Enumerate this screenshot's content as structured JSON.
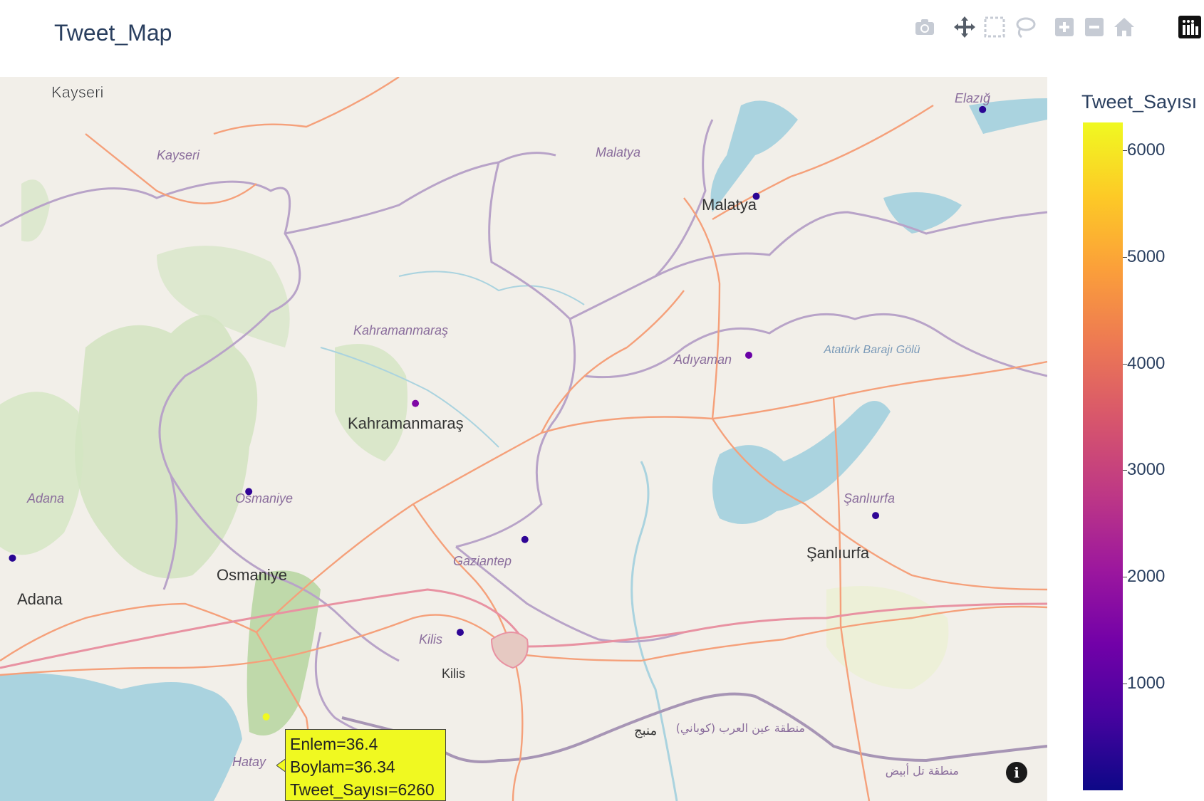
{
  "page": {
    "title": "Tweet_Map"
  },
  "modebar": {
    "icons": [
      "camera-icon",
      "pan-icon",
      "box-select-icon",
      "lasso-icon",
      "zoom-in-icon",
      "zoom-out-icon",
      "home-icon",
      "plotly-logo-icon"
    ]
  },
  "map": {
    "places": [
      {
        "name": "Kayseri",
        "kind": "city"
      },
      {
        "name": "Kayseri",
        "kind": "province"
      },
      {
        "name": "Malatya",
        "kind": "province"
      },
      {
        "name": "Malatya",
        "kind": "city"
      },
      {
        "name": "Elazığ",
        "kind": "province"
      },
      {
        "name": "Kahramanmaraş",
        "kind": "province"
      },
      {
        "name": "Kahramanmaraş",
        "kind": "city"
      },
      {
        "name": "Adıyaman",
        "kind": "province"
      },
      {
        "name": "Atatürk Barajı Gölü",
        "kind": "water"
      },
      {
        "name": "Adana",
        "kind": "province"
      },
      {
        "name": "Osmaniye",
        "kind": "province"
      },
      {
        "name": "Osmaniye",
        "kind": "city"
      },
      {
        "name": "Adana",
        "kind": "city"
      },
      {
        "name": "Gaziantep",
        "kind": "province"
      },
      {
        "name": "Şanlıurfa",
        "kind": "province"
      },
      {
        "name": "Şanlıurfa",
        "kind": "city"
      },
      {
        "name": "Kilis",
        "kind": "province"
      },
      {
        "name": "Kilis",
        "kind": "city"
      },
      {
        "name": "Hatay",
        "kind": "province"
      },
      {
        "name": "منبج",
        "kind": "city"
      },
      {
        "name": "منطقة عين العرب (كوباني)",
        "kind": "region"
      },
      {
        "name": "منطقة تل أبيض",
        "kind": "region"
      }
    ],
    "points": [
      {
        "lat": 38.67,
        "lon": 39.22,
        "tweets": 350
      },
      {
        "lat": 38.35,
        "lon": 38.31,
        "tweets": 380
      },
      {
        "lat": 37.76,
        "lon": 38.28,
        "tweets": 1250
      },
      {
        "lat": 37.58,
        "lon": 36.94,
        "tweets": 1600
      },
      {
        "lat": 37.25,
        "lon": 36.27,
        "tweets": 450
      },
      {
        "lat": 37.07,
        "lon": 37.38,
        "tweets": 420
      },
      {
        "lat": 37.16,
        "lon": 38.79,
        "tweets": 410
      },
      {
        "lat": 37.0,
        "lon": 35.32,
        "tweets": 330
      },
      {
        "lat": 36.72,
        "lon": 37.12,
        "tweets": 400
      },
      {
        "lat": 36.4,
        "lon": 36.34,
        "tweets": 6260
      }
    ]
  },
  "colorbar": {
    "title": "Tweet_Sayısı",
    "ticks": [
      "6000",
      "5000",
      "4000",
      "3000",
      "2000",
      "1000"
    ],
    "colorscale": [
      "#0d0887",
      "#46039f",
      "#7201a8",
      "#9c179e",
      "#bd3786",
      "#d8576b",
      "#ed7953",
      "#fb9f3a",
      "#fdca26",
      "#f0f921"
    ]
  },
  "tooltip": {
    "lines": [
      "Enlem=36.4",
      "Boylam=36.34",
      "Tweet_Sayısı=6260"
    ],
    "bg": "#f0f921"
  },
  "info": {
    "label": "i"
  }
}
